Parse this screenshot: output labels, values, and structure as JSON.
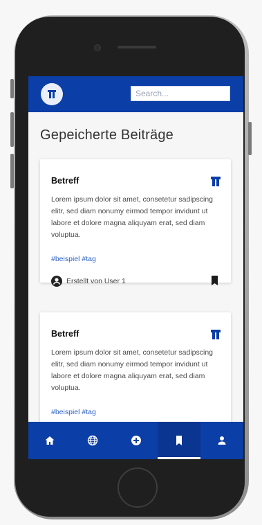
{
  "app": {
    "header": {
      "search_placeholder": "Search..."
    },
    "page_title": "Gepeicherte Beiträge",
    "posts": [
      {
        "subject": "Betreff",
        "text": "Lorem ipsum dolor sit amet, consetetur sadipscing elitr, sed diam nonumy eirmod tempor invidunt ut labore et dolore magna aliquyam erat, sed diam voluptua.",
        "tags": "#beispiel #tag",
        "author": "Erstellt von User 1"
      },
      {
        "subject": "Betreff",
        "text": "Lorem ipsum dolor sit amet, consetetur sadipscing elitr, sed diam nonumy eirmod tempor invidunt ut labore et dolore magna aliquyam erat, sed diam voluptua.",
        "tags": "#beispiel #tag"
      }
    ],
    "nav": [
      {
        "icon": "home-icon",
        "active": false
      },
      {
        "icon": "globe-icon",
        "active": false
      },
      {
        "icon": "add-circle-icon",
        "active": false
      },
      {
        "icon": "bookmark-icon",
        "active": true
      },
      {
        "icon": "person-icon",
        "active": false
      }
    ],
    "colors": {
      "brand": "#0b3ea6",
      "link": "#2d63c8"
    }
  }
}
